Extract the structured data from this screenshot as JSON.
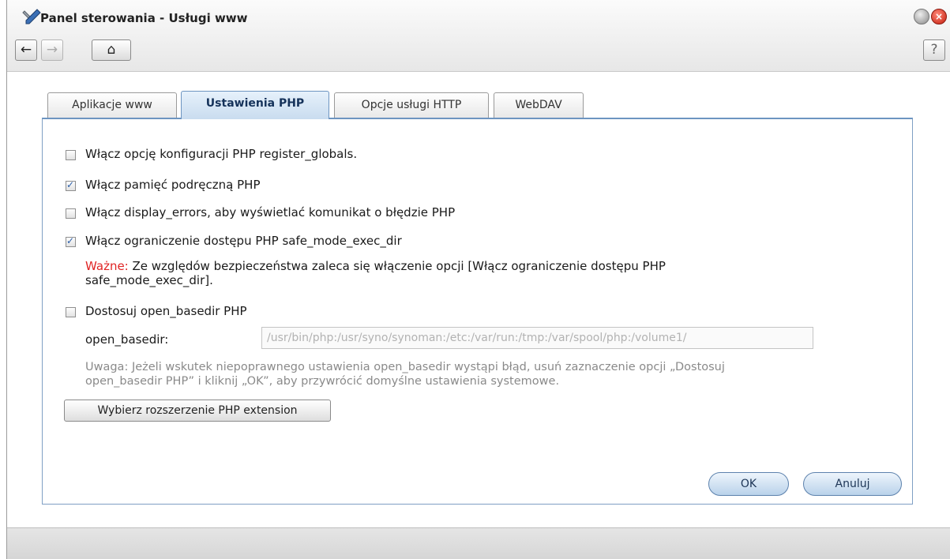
{
  "window": {
    "title": "Panel sterowania - Usługi www",
    "close_glyph": "×"
  },
  "toolbar": {
    "back_glyph": "←",
    "forward_glyph": "→",
    "home_glyph": "⌂",
    "help_glyph": "?"
  },
  "tabs": [
    {
      "label": "Aplikacje www",
      "active": false
    },
    {
      "label": "Ustawienia PHP",
      "active": true
    },
    {
      "label": "Opcje usługi HTTP",
      "active": false
    },
    {
      "label": "WebDAV",
      "active": false
    }
  ],
  "options": [
    {
      "label": "Włącz opcję konfiguracji PHP register_globals.",
      "checked": false
    },
    {
      "label": "Włącz pamięć podręczną PHP",
      "checked": true
    },
    {
      "label": "Włącz display_errors, aby wyświetlać komunikat o błędzie PHP",
      "checked": false
    },
    {
      "label": "Włącz ograniczenie dostępu PHP safe_mode_exec_dir",
      "checked": true
    },
    {
      "label": "Dostosuj open_basedir PHP",
      "checked": false
    }
  ],
  "important_note": {
    "prefix": "Ważne:",
    "text_line1": " Ze względów bezpieczeństwa zaleca się włączenie opcji [Włącz ograniczenie dostępu PHP",
    "text_line2": "safe_mode_exec_dir]."
  },
  "open_basedir": {
    "label": "open_basedir:",
    "value": "/usr/bin/php:/usr/syno/synoman:/etc:/var/run:/tmp:/var/spool/php:/volume1/"
  },
  "basedir_note": {
    "line1": "Uwaga: Jeżeli wskutek niepoprawnego ustawienia open_basedir wystąpi błąd, usuń zaznaczenie opcji „Dostosuj",
    "line2": "open_basedir PHP” i kliknij „OK”, aby przywrócić domyślne ustawienia systemowe."
  },
  "buttons": {
    "extension": "Wybierz rozszerzenie PHP extension",
    "ok": "OK",
    "cancel": "Anuluj"
  },
  "colors": {
    "warning": "#e02424",
    "accent": "#6d95c1"
  },
  "icons": {
    "title": "tools-icon",
    "back": "arrow-left-icon",
    "forward": "arrow-right-icon",
    "home": "home-icon",
    "help": "help-icon"
  }
}
